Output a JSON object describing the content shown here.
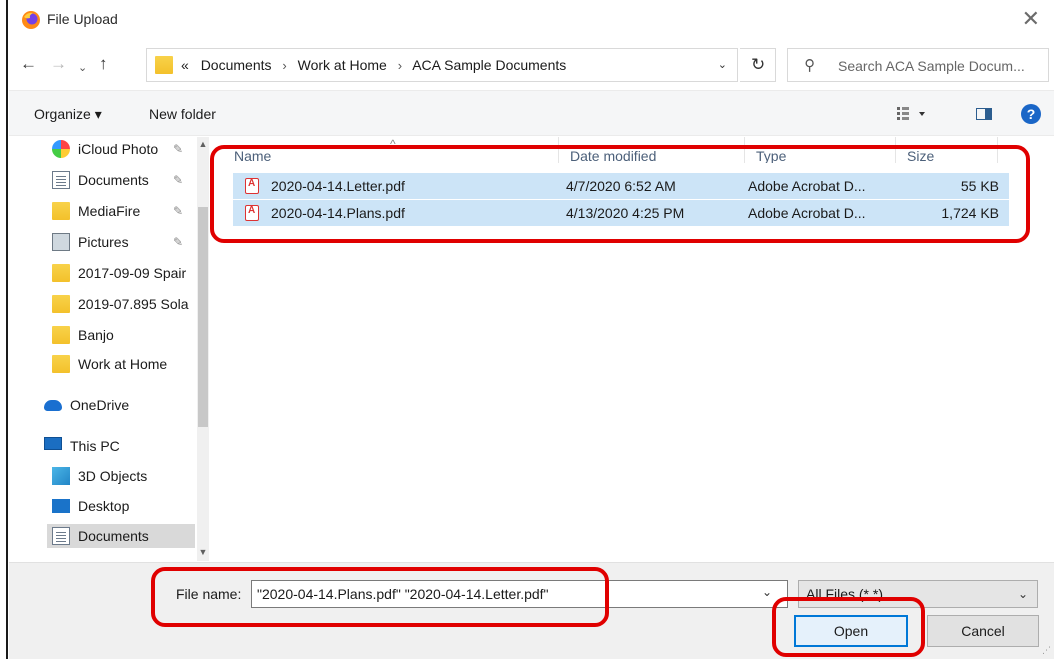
{
  "window": {
    "title": "File Upload",
    "close_glyph": "✕"
  },
  "nav": {
    "back": "←",
    "forward": "→",
    "recent": "⌄",
    "up": "↑",
    "breadcrumb_overflow": "«",
    "breadcrumbs": [
      "Documents",
      "Work at Home",
      "ACA Sample Documents"
    ],
    "separator": "›",
    "address_dropdown": "⌄",
    "refresh": "↻",
    "search_placeholder": "Search ACA Sample Docum..."
  },
  "toolbar": {
    "organize": "Organize ▾",
    "new_folder": "New folder",
    "help": "?"
  },
  "sidebar": {
    "items": [
      {
        "label": "iCloud Photo",
        "pinned": true,
        "icon": "icloud-photos-icon"
      },
      {
        "label": "Documents",
        "pinned": true,
        "icon": "document-icon"
      },
      {
        "label": "MediaFire",
        "pinned": true,
        "icon": "folder-icon"
      },
      {
        "label": "Pictures",
        "pinned": true,
        "icon": "pictures-icon"
      },
      {
        "label": "2017-09-09 Spair",
        "pinned": false,
        "icon": "folder-icon"
      },
      {
        "label": "2019-07.895 Sola",
        "pinned": false,
        "icon": "folder-icon"
      },
      {
        "label": "Banjo",
        "pinned": false,
        "icon": "folder-icon"
      },
      {
        "label": "Work at Home",
        "pinned": false,
        "icon": "folder-icon"
      },
      {
        "label": "OneDrive",
        "pinned": false,
        "icon": "onedrive-icon"
      },
      {
        "label": "This PC",
        "pinned": false,
        "icon": "computer-icon"
      },
      {
        "label": "3D Objects",
        "pinned": false,
        "icon": "3d-objects-icon"
      },
      {
        "label": "Desktop",
        "pinned": false,
        "icon": "desktop-icon"
      },
      {
        "label": "Documents",
        "pinned": false,
        "icon": "document-icon",
        "selected": true
      }
    ],
    "pin_glyph": "📌"
  },
  "filelist": {
    "columns": [
      "Name",
      "Date modified",
      "Type",
      "Size"
    ],
    "sort_glyph": "^",
    "rows": [
      {
        "name": "2020-04-14.Letter.pdf",
        "date": "4/7/2020 6:52 AM",
        "type": "Adobe Acrobat D...",
        "size": "55 KB"
      },
      {
        "name": "2020-04-14.Plans.pdf",
        "date": "4/13/2020 4:25 PM",
        "type": "Adobe Acrobat D...",
        "size": "1,724 KB"
      }
    ]
  },
  "bottom": {
    "file_name_label": "File name:",
    "file_name_value": "\"2020-04-14.Plans.pdf\" \"2020-04-14.Letter.pdf\"",
    "file_type": "All Files (*.*)",
    "dropdown_glyph": "⌄",
    "open_label": "Open",
    "cancel_label": "Cancel"
  },
  "colors": {
    "selection": "#cce4f7",
    "highlight": "#e00000",
    "accent": "#0078d7"
  }
}
